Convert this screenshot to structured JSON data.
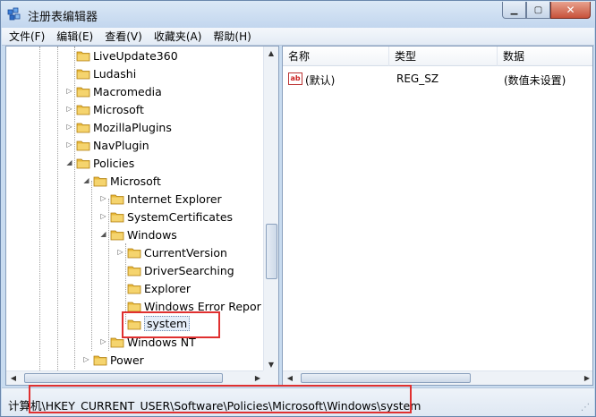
{
  "window": {
    "title": "注册表编辑器"
  },
  "menu": [
    {
      "label": "文件(F)"
    },
    {
      "label": "编辑(E)"
    },
    {
      "label": "查看(V)"
    },
    {
      "label": "收藏夹(A)"
    },
    {
      "label": "帮助(H)"
    }
  ],
  "tree": [
    {
      "label": "LiveUpdate360",
      "expander": ""
    },
    {
      "label": "Ludashi",
      "expander": ""
    },
    {
      "label": "Macromedia",
      "expander": "▷"
    },
    {
      "label": "Microsoft",
      "expander": "▷"
    },
    {
      "label": "MozillaPlugins",
      "expander": "▷"
    },
    {
      "label": "NavPlugin",
      "expander": "▷"
    },
    {
      "label": "Policies",
      "expander": "◢"
    },
    {
      "label": "Microsoft",
      "expander": "◢"
    },
    {
      "label": "Internet Explorer",
      "expander": "▷"
    },
    {
      "label": "SystemCertificates",
      "expander": "▷"
    },
    {
      "label": "Windows",
      "expander": "◢"
    },
    {
      "label": "CurrentVersion",
      "expander": "▷"
    },
    {
      "label": "DriverSearching",
      "expander": ""
    },
    {
      "label": "Explorer",
      "expander": ""
    },
    {
      "label": "Windows Error Repor",
      "expander": ""
    },
    {
      "label": "system",
      "expander": ""
    },
    {
      "label": "Windows NT",
      "expander": "▷"
    },
    {
      "label": "Power",
      "expander": "▷"
    }
  ],
  "columns": [
    {
      "label": "名称"
    },
    {
      "label": "类型"
    },
    {
      "label": "数据"
    }
  ],
  "values": [
    {
      "name": "(默认)",
      "type": "REG_SZ",
      "data": "(数值未设置)",
      "icon": "string-value-icon"
    }
  ],
  "status": {
    "path": "计算机\\HKEY_CURRENT_USER\\Software\\Policies\\Microsoft\\Windows\\system"
  },
  "colors": {
    "highlight": "#e03030",
    "folder": "#e8b83a"
  }
}
